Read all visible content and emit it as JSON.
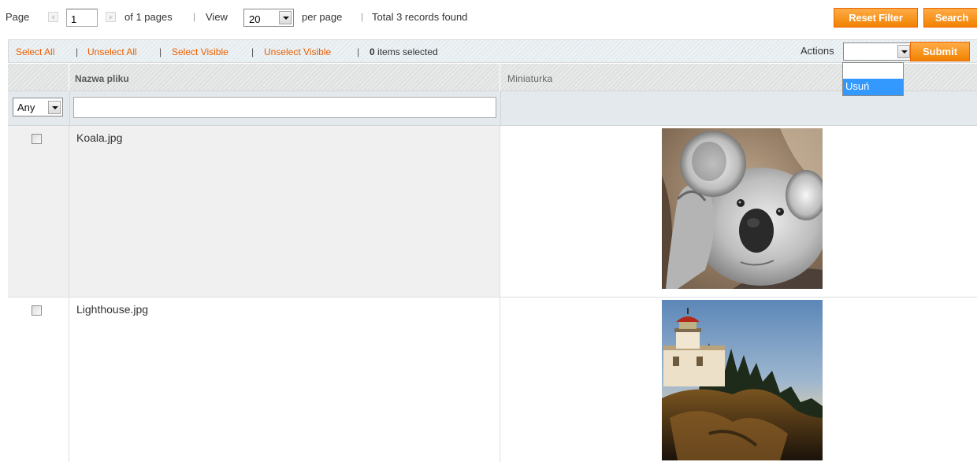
{
  "pager": {
    "page_label": "Page",
    "page_value": "1",
    "of_pages": "of 1 pages",
    "view_label": "View",
    "view_value": "20",
    "per_page": "per page",
    "total": "Total 3 records found",
    "reset_filter": "Reset Filter",
    "search": "Search"
  },
  "massaction": {
    "select_all": "Select All",
    "unselect_all": "Unselect All",
    "select_visible": "Select Visible",
    "unselect_visible": "Unselect Visible",
    "items_count": "0",
    "items_selected": "items selected",
    "actions_label": "Actions",
    "actions_value": "",
    "actions_options": [
      "",
      "Usuń"
    ],
    "submit": "Submit"
  },
  "grid": {
    "columns": [
      "Nazwa pliku",
      "Miniaturka"
    ],
    "filter_any": "Any",
    "filter_name_value": "",
    "rows": [
      {
        "name": "Koala.jpg",
        "checked": false,
        "thumbnail": "koala-image"
      },
      {
        "name": "Lighthouse.jpg",
        "checked": false,
        "thumbnail": "lighthouse-image"
      }
    ]
  },
  "colors": {
    "accent_orange": "#f18200",
    "link_orange": "#eb5e00",
    "select_highlight": "#3399ff"
  }
}
